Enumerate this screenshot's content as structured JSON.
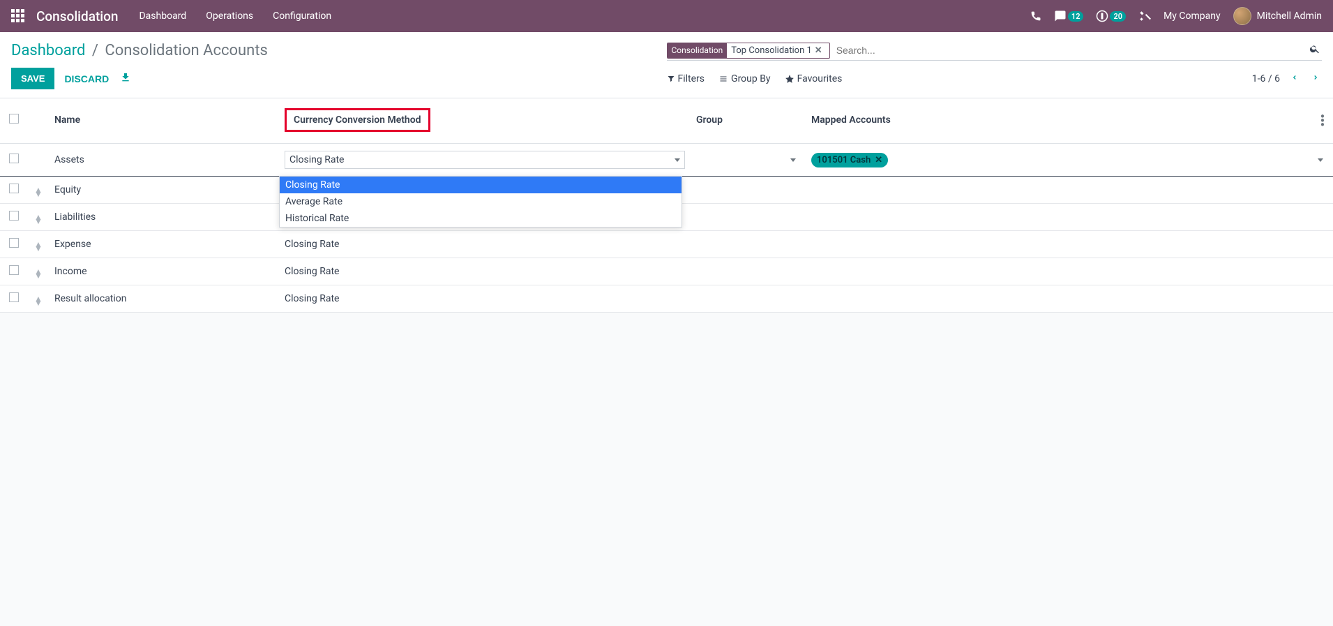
{
  "topnav": {
    "brand": "Consolidation",
    "menu": [
      "Dashboard",
      "Operations",
      "Configuration"
    ],
    "badge_messages": "12",
    "badge_activities": "20",
    "company": "My Company",
    "user": "Mitchell Admin"
  },
  "breadcrumb": {
    "root": "Dashboard",
    "current": "Consolidation Accounts"
  },
  "search": {
    "facet_label": "Consolidation",
    "facet_value": "Top Consolidation 1",
    "placeholder": "Search..."
  },
  "buttons": {
    "save": "SAVE",
    "discard": "DISCARD"
  },
  "toolbar": {
    "filters": "Filters",
    "groupby": "Group By",
    "favourites": "Favourites"
  },
  "pager": {
    "text": "1-6 / 6"
  },
  "columns": {
    "name": "Name",
    "method": "Currency Conversion Method",
    "group": "Group",
    "mapped": "Mapped Accounts"
  },
  "dropdown_options": [
    "Closing Rate",
    "Average Rate",
    "Historical Rate"
  ],
  "rows": [
    {
      "name": "Assets",
      "method": "Closing Rate",
      "group": "",
      "mapped_tag": "101501 Cash",
      "editing": true
    },
    {
      "name": "Equity",
      "method": "Closing Rate",
      "group": "",
      "mapped_tag": ""
    },
    {
      "name": "Liabilities",
      "method": "Closing Rate",
      "group": "",
      "mapped_tag": ""
    },
    {
      "name": "Expense",
      "method": "Closing Rate",
      "group": "",
      "mapped_tag": ""
    },
    {
      "name": "Income",
      "method": "Closing Rate",
      "group": "",
      "mapped_tag": ""
    },
    {
      "name": "Result allocation",
      "method": "Closing Rate",
      "group": "",
      "mapped_tag": ""
    }
  ]
}
